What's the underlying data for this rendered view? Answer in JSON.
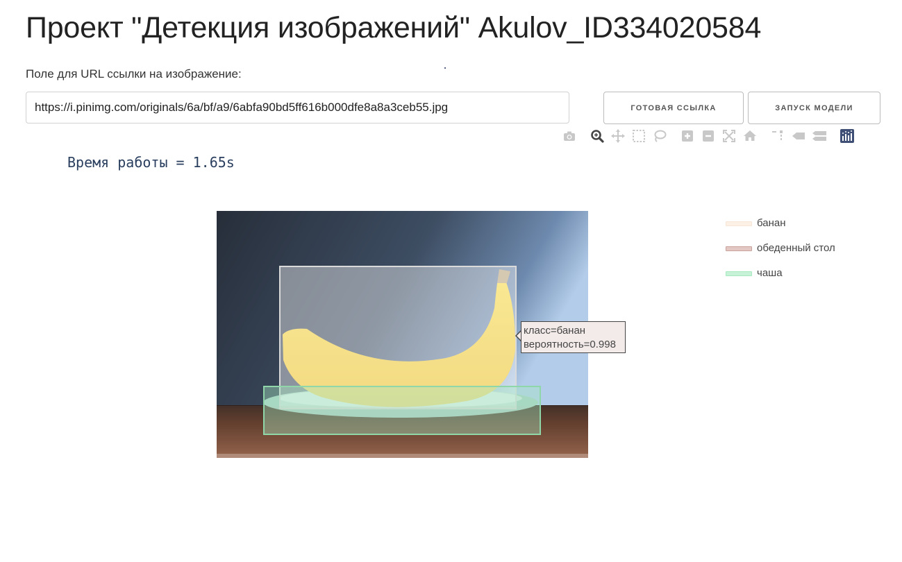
{
  "header": {
    "title": "Проект \"Детекция изображений\" Akulov_ID334020584"
  },
  "form": {
    "url_label": "Поле для URL ссылки на изображение:",
    "url_value": "https://i.pinimg.com/originals/6a/bf/a9/6abfa90bd5ff616b000dfe8a8a3ceb55.jpg",
    "ready_link_button": "ГОТОВАЯ ССЫЛКА",
    "run_model_button": "ЗАПУСК МОДЕЛИ"
  },
  "modebar": {
    "icons": [
      "camera-icon",
      "zoom-icon",
      "pan-icon",
      "box-select-icon",
      "lasso-select-icon",
      "zoom-in-icon",
      "zoom-out-icon",
      "autoscale-icon",
      "reset-axes-icon",
      "spike-lines-icon",
      "hover-closest-icon",
      "hover-compare-icon",
      "plotly-logo-icon"
    ],
    "active": "zoom-icon"
  },
  "result": {
    "runtime_text": "Время работы = 1.65s"
  },
  "tooltip": {
    "line1": "класс=банан",
    "line2": "вероятность=0.998"
  },
  "legend": {
    "items": [
      {
        "label": "банан",
        "color": "#fdf1e6"
      },
      {
        "label": "обеденный стол",
        "color": "#d4aca6"
      },
      {
        "label": "чаша",
        "color": "#a6e8c0"
      }
    ]
  },
  "colors": {
    "accent": "#2a3f5f",
    "banana_box": "#d9d9d9",
    "bowl_box": "#8fd6a8"
  }
}
